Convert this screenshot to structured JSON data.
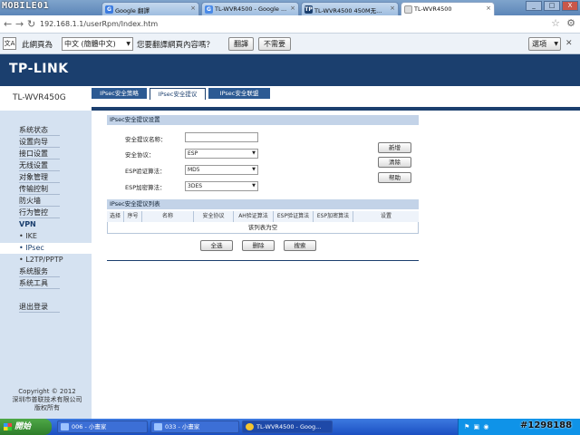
{
  "browser": {
    "logo": "MOBILE01",
    "tabs": [
      {
        "label": "Google 翻譯",
        "icon": "G"
      },
      {
        "label": "TL-WVR4500 - Google ...",
        "icon": "G"
      },
      {
        "label": "TL-WVR4500 450M无...",
        "icon": "TP"
      },
      {
        "label": "TL-WVR4500",
        "icon": ""
      }
    ],
    "url": "192.168.1.1/userRpm/Index.htm",
    "window_controls": [
      "_",
      "□",
      "X"
    ]
  },
  "translate_bar": {
    "prefix": "此網頁為",
    "language": "中文 (簡體中文)",
    "question": "您要翻譯網頁內容嗎？",
    "translate_button": "翻譯",
    "no_button": "不需要",
    "options": "選項"
  },
  "router": {
    "brand": "TP-LINK",
    "model": "TL-WVR450G",
    "tabs": [
      "IPsec安全策略",
      "IPsec安全提议",
      "IPsec安全联盟"
    ],
    "active_tab": 1
  },
  "sidebar": {
    "items": [
      "系统状态",
      "设置向导",
      "接口设置",
      "无线设置",
      "对象管理",
      "传输控制",
      "防火墙",
      "行为管控",
      "VPN",
      "• IKE",
      "• IPsec",
      "• L2TP/PPTP",
      "系统服务",
      "系统工具",
      "退出登录"
    ],
    "selected": "• IPsec",
    "copyright": [
      "Copyright © 2012",
      "深圳市普联技术有限公司",
      "版权所有"
    ]
  },
  "settings": {
    "title": "IPsec安全提议设置",
    "fields": {
      "name_label": "安全提议名称：",
      "name_value": "",
      "protocol_label": "安全协议：",
      "protocol_value": "ESP",
      "ah_label": "ESP验证算法：",
      "ah_value": "MD5",
      "esp_label": "ESP加密算法：",
      "esp_value": "3DES"
    },
    "buttons": {
      "add": "新增",
      "clear": "清除",
      "help": "帮助"
    }
  },
  "list": {
    "title": "IPsec安全提议列表",
    "columns": [
      "选择",
      "序号",
      "名称",
      "安全协议",
      "AH验证算法",
      "ESP验证算法",
      "ESP加密算法",
      "设置"
    ],
    "empty": "该列表为空",
    "buttons": {
      "select_all": "全选",
      "delete": "删除",
      "search": "搜索"
    }
  },
  "taskbar": {
    "start": "開始",
    "tasks": [
      "006 - 小畫家",
      "033 - 小畫家",
      "TL-WVR4500 - Goog..."
    ],
    "watermark": "#1298188"
  }
}
